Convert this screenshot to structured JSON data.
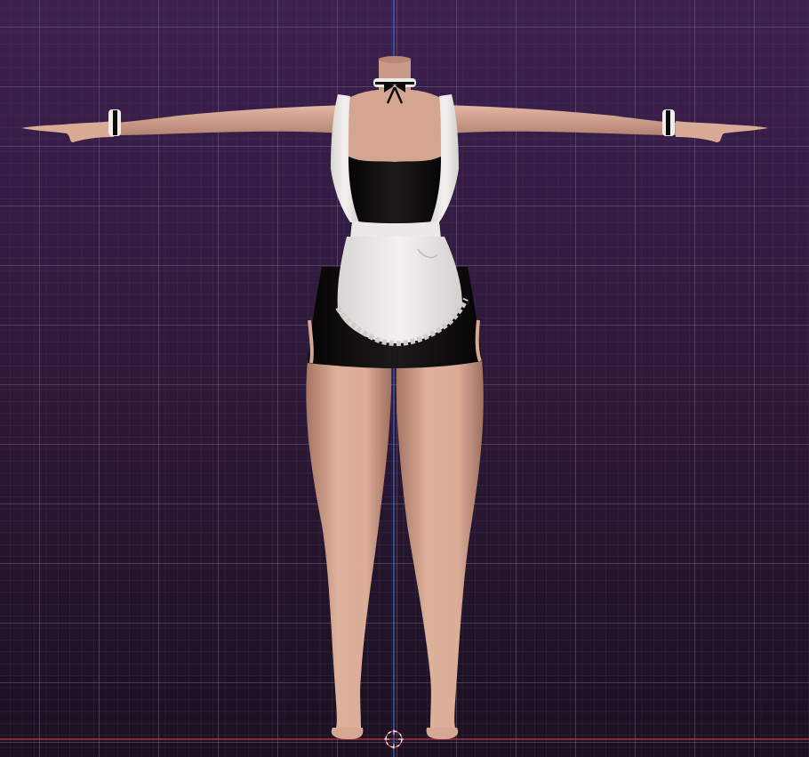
{
  "viewport": {
    "background_top": "#3b1f4a",
    "background_bottom": "#1d1221",
    "grid_color": "#6e5a7a",
    "minor_grid_color": "#4a3857",
    "z_axis_color": "#3f6fd6",
    "x_axis_color": "#c23a4c",
    "cursor_color": "#ff8090"
  },
  "model": {
    "skin_color": "#d8aa95",
    "skin_shadow": "#a9786a",
    "dress_color": "#0e0c0d",
    "apron_color": "#f0eeec",
    "apron_shadow": "#c9c6c4"
  },
  "icons": {
    "cursor": "3d-cursor-icon"
  }
}
